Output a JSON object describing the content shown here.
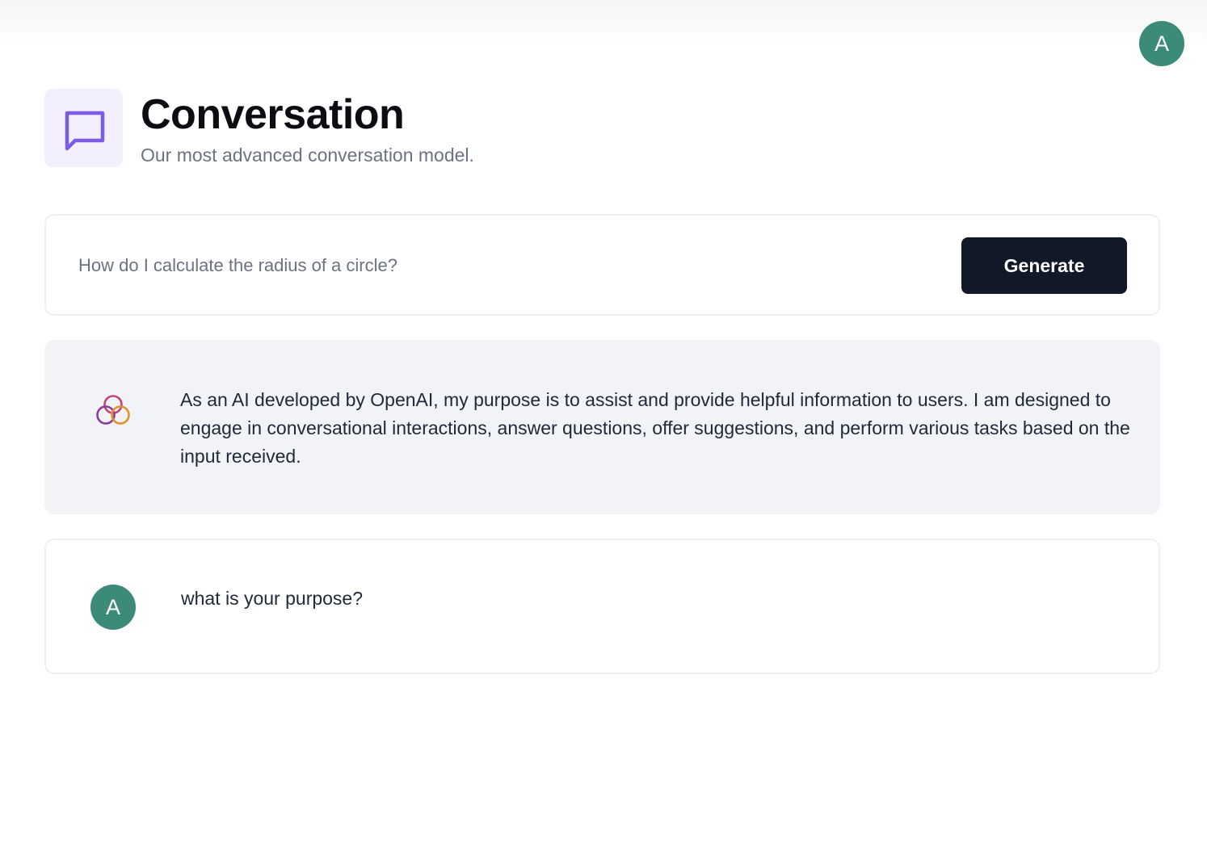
{
  "header": {
    "avatar_initial": "A"
  },
  "page": {
    "title": "Conversation",
    "subtitle": "Our most advanced conversation model.",
    "icon": "message-square-icon",
    "icon_color": "#7c5ce6",
    "icon_bg": "#f3effd"
  },
  "prompt": {
    "placeholder": "How do I calculate the radius of a circle?",
    "value": "",
    "generate_label": "Generate"
  },
  "messages": [
    {
      "role": "bot",
      "icon": "openai-logo-icon",
      "text": "As an AI developed by OpenAI, my purpose is to assist and provide helpful information to users. I am designed to engage in conversational interactions, answer questions, offer suggestions, and perform various tasks based on the input received."
    },
    {
      "role": "user",
      "avatar_initial": "A",
      "text": "what is your purpose?"
    }
  ],
  "colors": {
    "avatar": "#3b8b78",
    "button": "#111827",
    "bot_message_bg": "#f1f3f7"
  }
}
